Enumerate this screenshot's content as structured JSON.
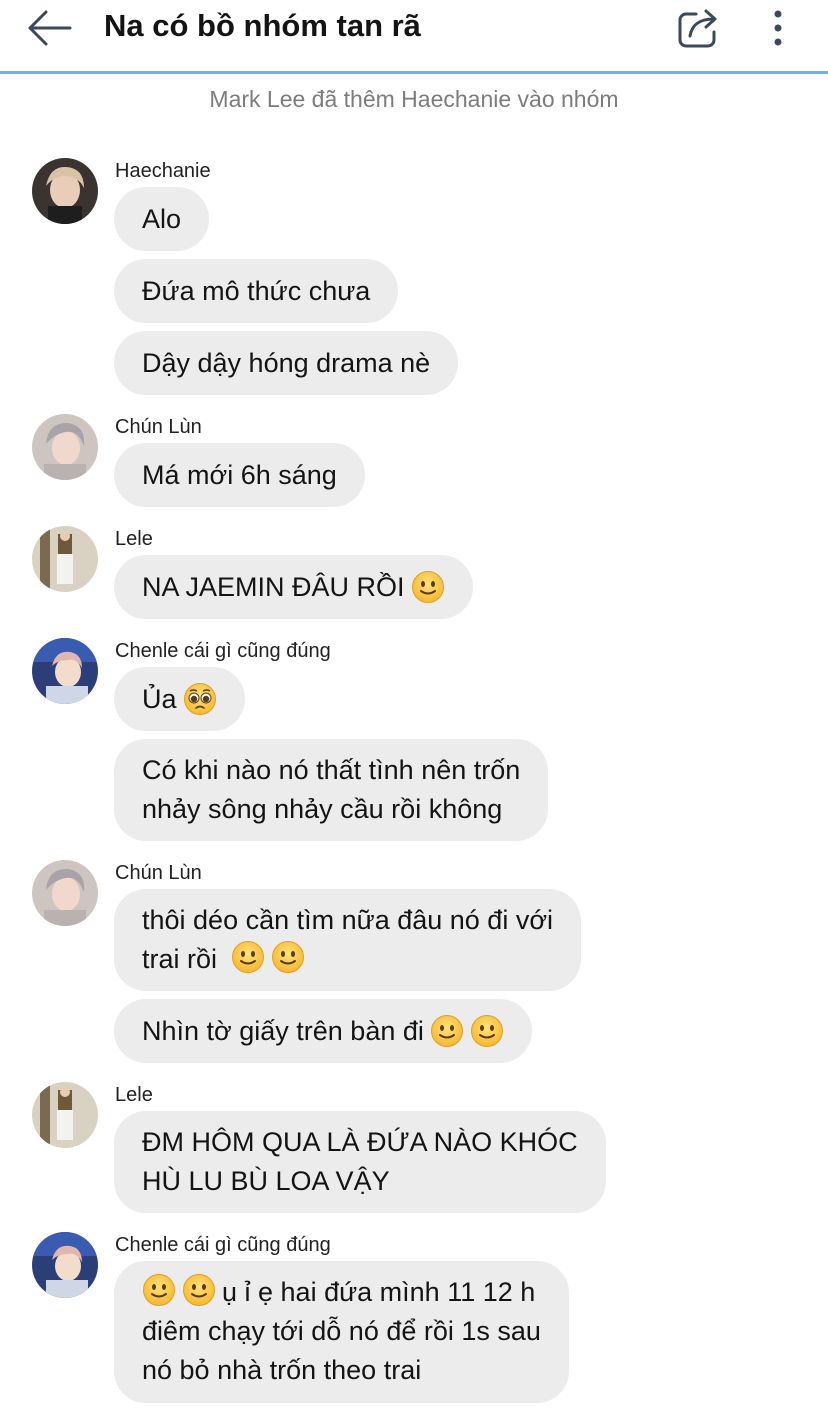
{
  "header": {
    "title": "Na có bồ nhóm tan rã",
    "back_icon": "arrow-left-icon",
    "share_icon": "share-icon",
    "more_icon": "more-vertical-icon"
  },
  "system_message": "Mark Lee đã thêm Haechanie vào nhóm",
  "groups": [
    {
      "sender": "Haechanie",
      "messages": [
        "Alo",
        "Đứa mô thức chưa",
        "Dậy dậy hóng drama nè"
      ]
    },
    {
      "sender": "Chún Lùn",
      "messages": [
        "Má mới 6h sáng"
      ]
    },
    {
      "sender": "Lele",
      "messages": [
        "NA JAEMIN ĐÂU RỒI"
      ]
    },
    {
      "sender": "Chenle cái gì cũng đúng",
      "messages": [
        "Ủa",
        "Có khi nào nó thất tình nên trốn",
        "nhảy sông nhảy cầu rồi không"
      ]
    },
    {
      "sender": "Chún Lùn",
      "messages": [
        "thôi déo cần tìm nữa đâu nó đi với",
        "trai rồi",
        "Nhìn tờ giấy trên bàn đi"
      ]
    },
    {
      "sender": "Lele",
      "messages": [
        "ĐM HÔM QUA LÀ ĐỨA NÀO KHÓC",
        "HÙ LU BÙ LOA VẬY"
      ]
    },
    {
      "sender": "Chenle cái gì cũng đúng",
      "messages": [
        "ụ ỉ ẹ hai đứa mình 11 12 h",
        "điêm chạy tới dỗ nó để rồi 1s sau",
        "nó bỏ nhà trốn theo trai"
      ]
    }
  ],
  "colors": {
    "bubble": "#ececec",
    "header_line": "#6fb3de",
    "system_text": "#7c7c7c"
  }
}
